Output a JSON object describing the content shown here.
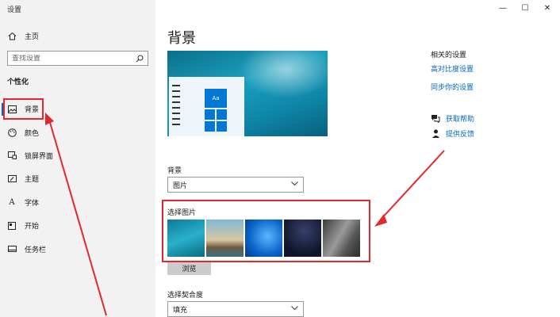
{
  "app": {
    "title": "设置"
  },
  "window": {
    "minimize": "—",
    "maximize": "☐",
    "close": "✕"
  },
  "sidebar": {
    "home_label": "主页",
    "search_placeholder": "查找设置",
    "section_title": "个性化",
    "items": [
      {
        "label": "背景",
        "icon": "image-icon",
        "selected": true
      },
      {
        "label": "颜色",
        "icon": "palette-icon"
      },
      {
        "label": "锁屏界面",
        "icon": "lock-screen-icon"
      },
      {
        "label": "主题",
        "icon": "theme-icon"
      },
      {
        "label": "字体",
        "icon": "font-icon"
      },
      {
        "label": "开始",
        "icon": "start-icon"
      },
      {
        "label": "任务栏",
        "icon": "taskbar-icon"
      }
    ]
  },
  "main": {
    "title": "背景",
    "preview_tile_label": "Aa",
    "background_label": "背景",
    "background_value": "图片",
    "choose_picture_label": "选择图片",
    "browse_label": "浏览",
    "fit_label": "选择契合度",
    "fit_value": "填充"
  },
  "related": {
    "title": "相关的设置",
    "links": [
      "高对比度设置",
      "同步你的设置"
    ],
    "help": [
      {
        "label": "获取帮助",
        "icon": "help-chat-icon"
      },
      {
        "label": "提供反馈",
        "icon": "feedback-icon"
      }
    ]
  },
  "colors": {
    "accent": "#0067c0",
    "annotation": "#e5262b",
    "sidebar_bg": "#f2f2f2"
  }
}
